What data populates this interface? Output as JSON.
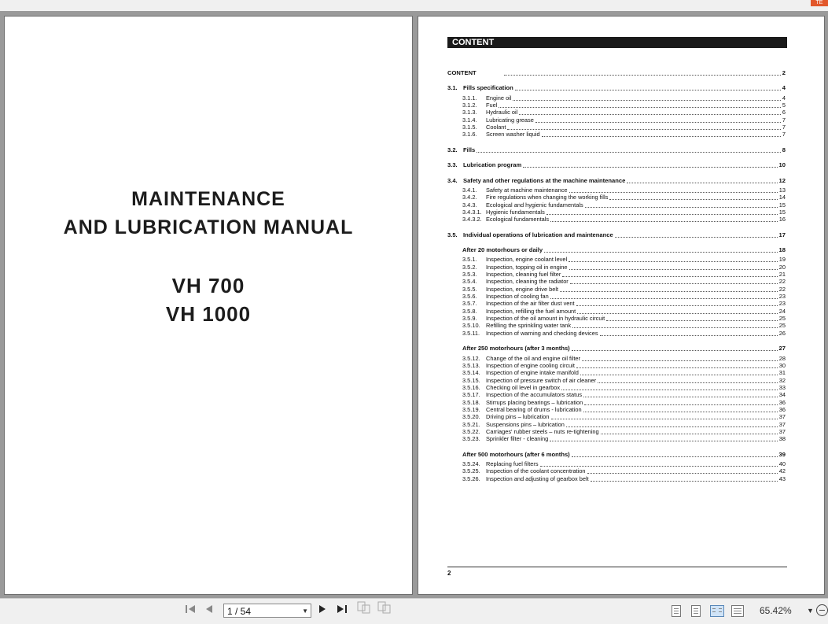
{
  "topbar": {
    "corner_label": "TE"
  },
  "cover": {
    "title_line1": "MAINTENANCE",
    "title_line2": "AND LUBRICATION MANUAL",
    "model1": "VH 700",
    "model2": "VH 1000"
  },
  "content_page": {
    "header": "CONTENT",
    "footer_page": "2",
    "entries": [
      {
        "num": "",
        "title": "CONTENT",
        "page": "2",
        "style": "bold"
      },
      {
        "num": "3.1.",
        "title": "Fills specification",
        "page": "4",
        "style": "sec"
      },
      {
        "num": "3.1.1.",
        "title": "Engine oil",
        "page": "4",
        "style": "sub"
      },
      {
        "num": "3.1.2.",
        "title": "Fuel",
        "page": "5",
        "style": "sub"
      },
      {
        "num": "3.1.3.",
        "title": "Hydraulic oil",
        "page": "6",
        "style": "sub"
      },
      {
        "num": "3.1.4.",
        "title": "Lubricating grease",
        "page": "7",
        "style": "sub"
      },
      {
        "num": "3.1.5.",
        "title": "Coolant",
        "page": "7",
        "style": "sub"
      },
      {
        "num": "3.1.6.",
        "title": "Screen washer liquid",
        "page": "7",
        "style": "sub"
      },
      {
        "num": "3.2.",
        "title": "Fills",
        "page": "8",
        "style": "sec"
      },
      {
        "num": "3.3.",
        "title": "Lubrication program",
        "page": "10",
        "style": "sec"
      },
      {
        "num": "3.4.",
        "title": "Safety and other regulations at the machine maintenance",
        "page": "12",
        "style": "sec"
      },
      {
        "num": "3.4.1.",
        "title": "Safety at machine maintenance",
        "page": "13",
        "style": "sub"
      },
      {
        "num": "3.4.2.",
        "title": "Fire regulations when changing the working fills",
        "page": "14",
        "style": "sub"
      },
      {
        "num": "3.4.3.",
        "title": "Ecological and hygienic fundamentals",
        "page": "15",
        "style": "sub"
      },
      {
        "num": "3.4.3.1.",
        "title": "Hygienic fundamentals",
        "page": "15",
        "style": "sub"
      },
      {
        "num": "3.4.3.2.",
        "title": "Ecological fundamentals",
        "page": "16",
        "style": "sub"
      },
      {
        "num": "3.5.",
        "title": "Individual operations of lubrication and maintenance",
        "page": "17",
        "style": "sec"
      },
      {
        "num": "",
        "title": "After 20 motorhours or daily",
        "page": "18",
        "style": "group"
      },
      {
        "num": "3.5.1.",
        "title": "Inspection, engine coolant level",
        "page": "19",
        "style": "sub"
      },
      {
        "num": "3.5.2.",
        "title": "Inspection, topping oil in engine",
        "page": "20",
        "style": "sub"
      },
      {
        "num": "3.5.3.",
        "title": "Inspection, cleaning fuel filter",
        "page": "21",
        "style": "sub"
      },
      {
        "num": "3.5.4.",
        "title": "Inspection, cleaning the radiator",
        "page": "22",
        "style": "sub"
      },
      {
        "num": "3.5.5.",
        "title": "Inspection, engine drive belt",
        "page": "22",
        "style": "sub"
      },
      {
        "num": "3.5.6.",
        "title": "Inspection of cooling fan",
        "page": "23",
        "style": "sub"
      },
      {
        "num": "3.5.7.",
        "title": "Inspection of the air filter dust vent",
        "page": "23",
        "style": "sub"
      },
      {
        "num": "3.5.8.",
        "title": "Inspection, refilling the fuel amount",
        "page": "24",
        "style": "sub"
      },
      {
        "num": "3.5.9.",
        "title": "Inspection of the oil amount in hydraulic circuit",
        "page": "25",
        "style": "sub"
      },
      {
        "num": "3.5.10.",
        "title": "Refilling the sprinkling water tank",
        "page": "25",
        "style": "sub"
      },
      {
        "num": "3.5.11.",
        "title": "Inspection of warning and checking devices",
        "page": "26",
        "style": "sub"
      },
      {
        "num": "",
        "title": "After 250 motorhours (after 3 months)",
        "page": "27",
        "style": "group"
      },
      {
        "num": "3.5.12.",
        "title": "Change of the oil and engine oil filter",
        "page": "28",
        "style": "sub"
      },
      {
        "num": "3.5.13.",
        "title": "Inspection of engine cooling circuit",
        "page": "30",
        "style": "sub"
      },
      {
        "num": "3.5.14.",
        "title": "Inspection of engine intake manifold",
        "page": "31",
        "style": "sub"
      },
      {
        "num": "3.5.15.",
        "title": "Inspection of pressure switch of air cleaner",
        "page": "32",
        "style": "sub"
      },
      {
        "num": "3.5.16.",
        "title": "Checking oil level in gearbox",
        "page": "33",
        "style": "sub"
      },
      {
        "num": "3.5.17.",
        "title": "Inspection of the accumulators status",
        "page": "34",
        "style": "sub"
      },
      {
        "num": "3.5.18.",
        "title": "Stirrups placing bearings – lubrication",
        "page": "36",
        "style": "sub"
      },
      {
        "num": "3.5.19.",
        "title": "Central bearing of drums - lubrication",
        "page": "36",
        "style": "sub"
      },
      {
        "num": "3.5.20.",
        "title": "Driving pins – lubrication",
        "page": "37",
        "style": "sub"
      },
      {
        "num": "3.5.21.",
        "title": "Suspensions pins – lubrication",
        "page": "37",
        "style": "sub"
      },
      {
        "num": "3.5.22.",
        "title": "Carriages' rubber steels – nuts re-tightening",
        "page": "37",
        "style": "sub"
      },
      {
        "num": "3.5.23.",
        "title": "Sprinkler filter - cleaning",
        "page": "38",
        "style": "sub"
      },
      {
        "num": "",
        "title": "After 500 motorhours (after 6 months)",
        "page": "39",
        "style": "group"
      },
      {
        "num": "3.5.24.",
        "title": "Replacing fuel filters",
        "page": "40",
        "style": "sub"
      },
      {
        "num": "3.5.25.",
        "title": "Inspection of the coolant concentration",
        "page": "42",
        "style": "sub"
      },
      {
        "num": "3.5.26.",
        "title": "Inspection and adjusting of gearbox belt",
        "page": "43",
        "style": "sub"
      }
    ]
  },
  "statusbar": {
    "first_icon": "first-page-icon",
    "prev_icon": "previous-page-icon",
    "page_indicator": "1 / 54",
    "next_icon": "next-page-icon",
    "last_icon": "last-page-icon",
    "zoom": "65.42%",
    "accent": "#cfe3f7"
  }
}
